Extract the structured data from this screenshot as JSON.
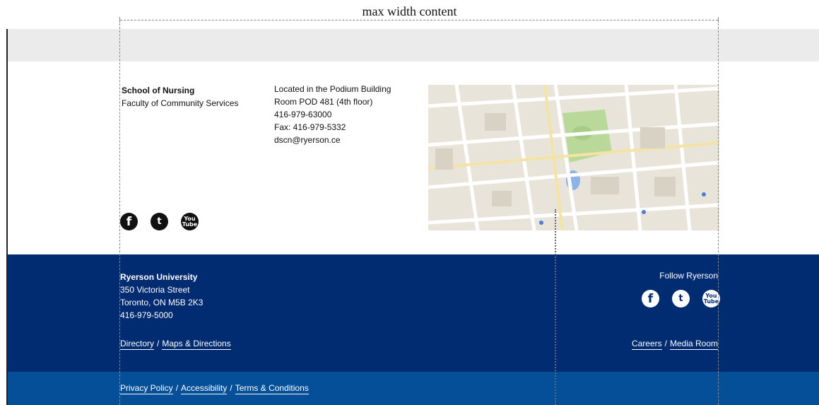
{
  "annotation": {
    "title": "max width content"
  },
  "contact": {
    "school_name": "School of Nursing",
    "faculty": "Faculty of Community Services",
    "location": "Located in the Podium Building",
    "room": "Room POD 481 (4th floor)",
    "phone": "416-979-63000",
    "fax": "Fax: 416-979-5332",
    "email": "dscn@ryerson.ce"
  },
  "social_icons": [
    "facebook-icon",
    "twitter-icon",
    "youtube-icon"
  ],
  "social_glyphs": {
    "facebook": "f",
    "twitter": "t",
    "youtube_top": "You",
    "youtube_bottom": "Tube"
  },
  "footer": {
    "university": "Ryerson University",
    "street": "350 Victoria Street",
    "city": "Toronto, ON M5B 2K3",
    "phone": "416-979-5000",
    "follow_label": "Follow Ryerson",
    "links_left": [
      "Directory",
      "Maps & Directions"
    ],
    "links_right": [
      "Careers",
      "Media Room"
    ],
    "legal_links": [
      "Privacy Policy",
      "Accessibility",
      "Terms & Conditions"
    ],
    "separator": "/"
  },
  "colors": {
    "footer_dark": "#022c72",
    "footer_light": "#054f99",
    "top_bar": "#ebebeb",
    "map_park": "#b9d99a",
    "map_water": "#8fb3e8"
  }
}
